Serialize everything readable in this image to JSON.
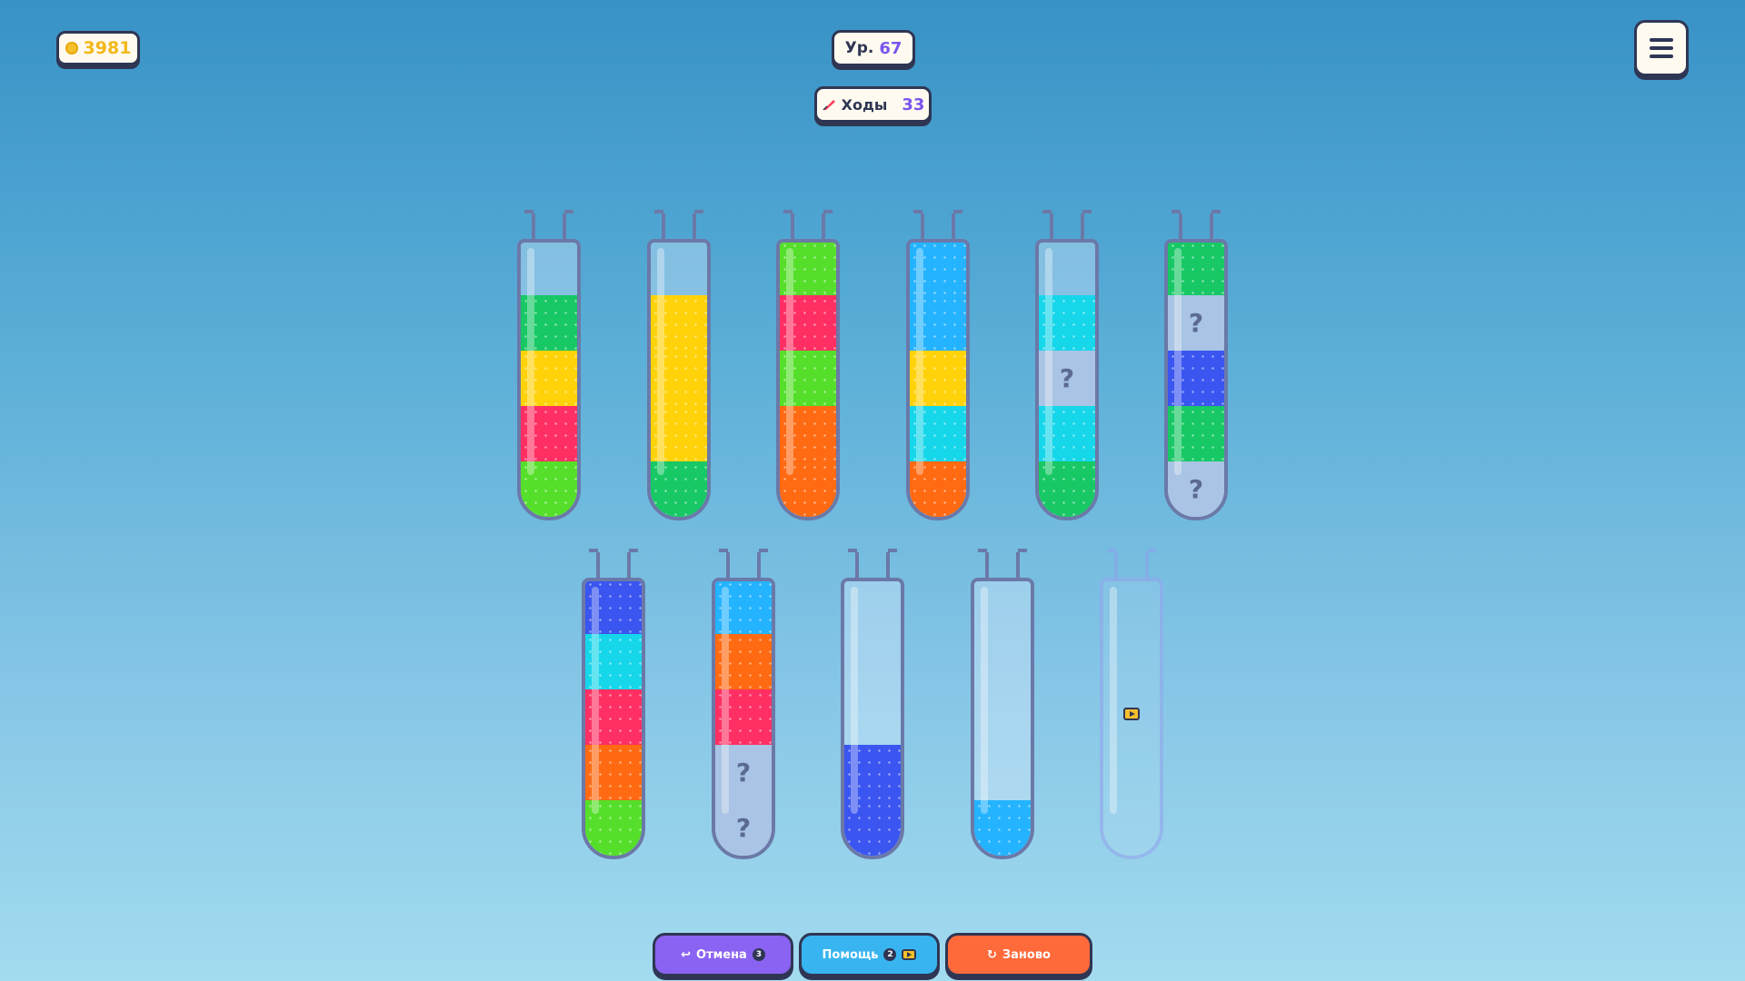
{
  "hud": {
    "coins": "3981",
    "level_label": "Ур.",
    "level_value": "67",
    "moves_label": "Ходы",
    "moves_value": "33"
  },
  "icons": {
    "coin": "coin-icon",
    "feather": "feather-icon",
    "menu": "menu-icon",
    "undo": "undo-icon",
    "video_ad": "video-ad-icon",
    "restart": "restart-icon"
  },
  "colors": {
    "green": "#17c865",
    "yellow": "#ffd20a",
    "red": "#ff2f63",
    "lime": "#55df2a",
    "orange": "#ff6a12",
    "skyblue": "#24b3ff",
    "cyan": "#16d6ea",
    "blue": "#3a55f0",
    "hidden": "#a9c4e4"
  },
  "tubes": [
    {
      "segments": [
        "green",
        "yellow",
        "red",
        "lime"
      ]
    },
    {
      "segments": [
        "yellow",
        "yellow",
        "yellow",
        "green"
      ]
    },
    {
      "segments": [
        "lime",
        "red",
        "lime",
        "orange",
        "orange"
      ]
    },
    {
      "segments": [
        "skyblue",
        "skyblue",
        "yellow",
        "cyan",
        "orange"
      ]
    },
    {
      "segments": [
        "cyan",
        "hidden",
        "cyan",
        "green"
      ]
    },
    {
      "segments": [
        "green",
        "hidden",
        "blue",
        "green",
        "hidden"
      ]
    },
    {
      "segments": [
        "blue",
        "cyan",
        "red",
        "orange",
        "lime"
      ]
    },
    {
      "segments": [
        "skyblue",
        "orange",
        "red",
        "hidden",
        "hidden"
      ]
    },
    {
      "segments": [
        "blue",
        "blue"
      ]
    },
    {
      "segments": [
        "skyblue"
      ]
    },
    {
      "segments": [],
      "locked_ad": true
    }
  ],
  "hidden_glyph": "?",
  "buttons": {
    "undo_label": "Отмена",
    "undo_count": "3",
    "help_label": "Помощь",
    "help_count": "2",
    "restart_label": "Заново",
    "undo_glyph": "↩",
    "restart_glyph": "↻"
  }
}
